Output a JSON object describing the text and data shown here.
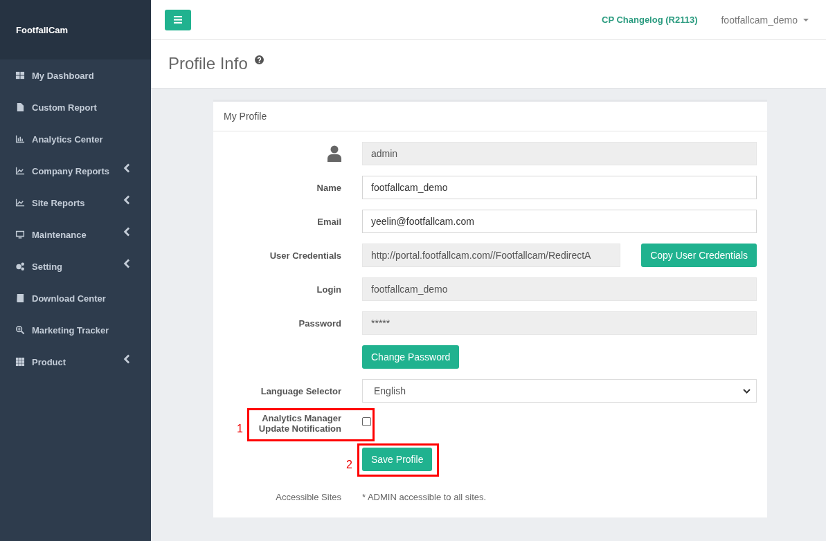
{
  "sidebar": {
    "brand": "FootfallCam",
    "items": [
      {
        "label": "My Dashboard",
        "submenu": false
      },
      {
        "label": "Custom Report",
        "submenu": false
      },
      {
        "label": "Analytics Center",
        "submenu": false
      },
      {
        "label": "Company Reports",
        "submenu": true
      },
      {
        "label": "Site Reports",
        "submenu": true
      },
      {
        "label": "Maintenance",
        "submenu": true
      },
      {
        "label": "Setting",
        "submenu": true
      },
      {
        "label": "Download Center",
        "submenu": false
      },
      {
        "label": "Marketing Tracker",
        "submenu": false
      },
      {
        "label": "Product",
        "submenu": true
      }
    ]
  },
  "header": {
    "changelog_link": "CP Changelog (R2113)",
    "user_menu": "footfallcam_demo"
  },
  "page_title": "Profile Info",
  "card": {
    "title": "My Profile",
    "rows": [
      {
        "kind": "user_field",
        "value": "admin",
        "disabled": true
      },
      {
        "kind": "field",
        "label": "Name",
        "value": "footfallcam_demo",
        "disabled": false
      },
      {
        "kind": "field",
        "label": "Email",
        "value": "yeelin@footfallcam.com",
        "disabled": false
      },
      {
        "kind": "field_button",
        "label": "User Credentials",
        "value": "http://portal.footfallcam.com//Footfallcam/RedirectA",
        "disabled": true,
        "button": "Copy User Credentials"
      },
      {
        "kind": "field",
        "label": "Login",
        "value": "footfallcam_demo",
        "disabled": true
      },
      {
        "kind": "field",
        "label": "Password",
        "value": "*****",
        "disabled": true
      },
      {
        "kind": "button",
        "button": "Change Password"
      },
      {
        "kind": "select",
        "label": "Language Selector",
        "value": "English"
      },
      {
        "kind": "checkbox",
        "label": "Analytics Manager Update Notification",
        "checked": false,
        "annotation": "1"
      },
      {
        "kind": "button",
        "button": "Save Profile",
        "annotation": "2"
      },
      {
        "kind": "text",
        "label": "Accessible Sites",
        "value": "* ADMIN accessible to all sites."
      }
    ]
  }
}
